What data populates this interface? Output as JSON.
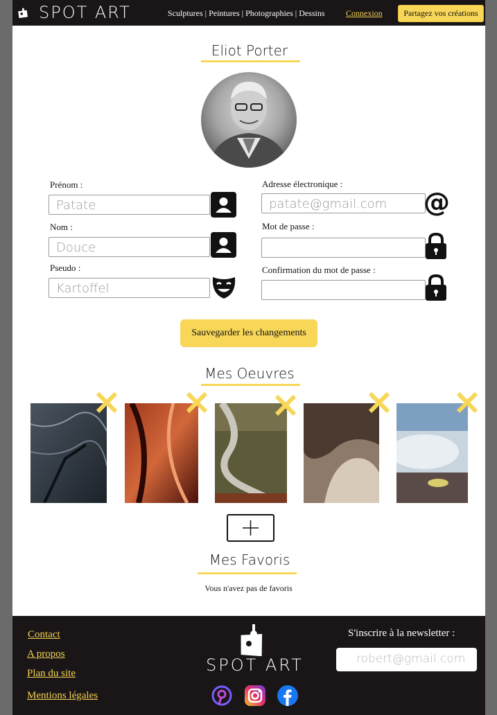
{
  "header": {
    "brand": "SPOT ART",
    "nav": "Sculptures | Peintures | Photographies | Dessins",
    "login": "Connexion",
    "share_button": "Partagez vos créations"
  },
  "profile": {
    "name": "Eliot Porter",
    "fields": {
      "first_name_label": "Prénom :",
      "first_name_value": "Patate",
      "last_name_label": "Nom :",
      "last_name_value": "Douce",
      "pseudo_label": "Pseudo :",
      "pseudo_value": "Kartoffel",
      "email_label": "Adresse électronique :",
      "email_value": "patate@gmail.com",
      "password_label": "Mot de passe :",
      "password_value": "",
      "confirm_label": "Confirmation du mot de passe :",
      "confirm_value": ""
    },
    "save_button": "Sauvegarder les changements"
  },
  "works": {
    "title": "Mes Oeuvres",
    "count": 5
  },
  "favorites": {
    "title": "Mes Favoris",
    "empty_text": "Vous n'avez pas de favoris"
  },
  "footer": {
    "links": [
      "Contact",
      "A propos",
      "Plan du site",
      "Mentions légales"
    ],
    "brand": "SPOT ART",
    "newsletter_label": "S'inscrire à la newsletter :",
    "newsletter_placeholder": "robert@gmail.com",
    "social_icons": [
      "pinterest-icon",
      "instagram-icon",
      "facebook-icon"
    ]
  },
  "colors": {
    "accent": "#f7d658",
    "dark": "#1a1617"
  }
}
